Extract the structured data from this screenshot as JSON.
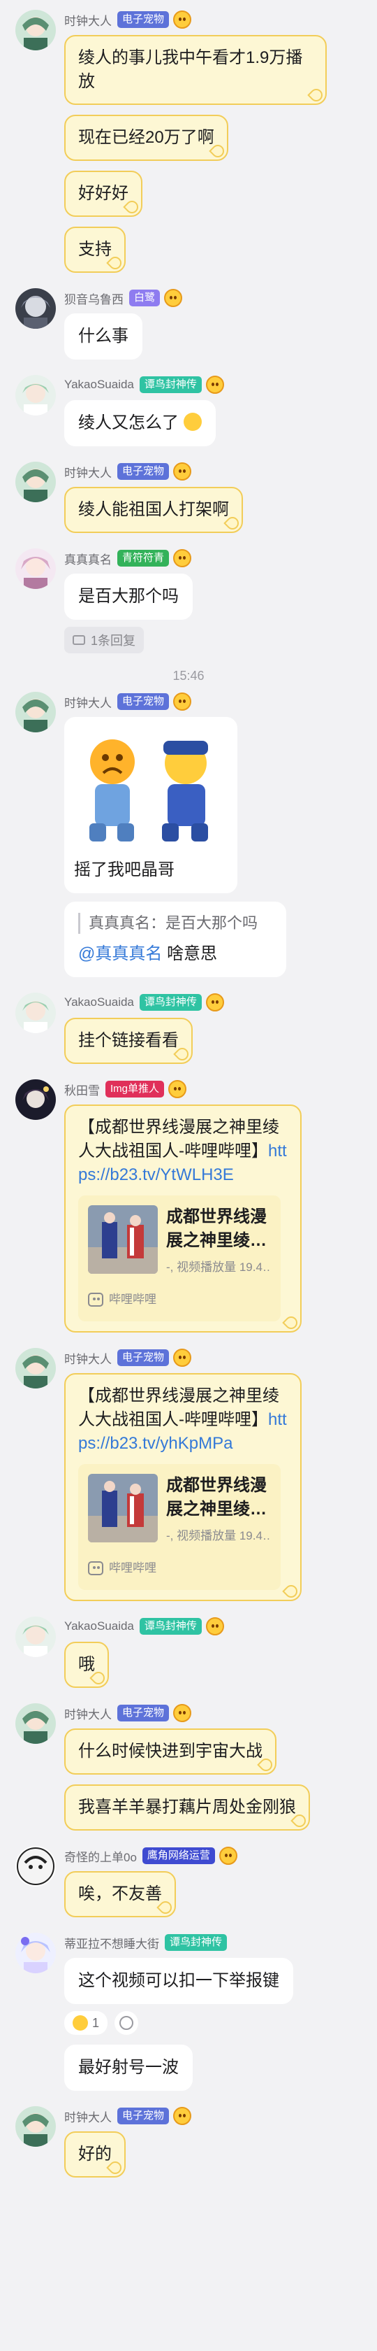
{
  "badges": {
    "pet": "电子宠物",
    "nebula": "白鹭",
    "bird": "谭鸟封神传",
    "green": "青符符青",
    "img": "Img单推人",
    "net": "鹰角网络运营"
  },
  "users": {
    "shizhong": "时钟大人",
    "mu": "狈音乌鲁西",
    "yakao": "YakaoSuaida",
    "zhen": "真真真名",
    "qiu": "秋田雪",
    "qiyi": "奇怪的上单0o",
    "diya": "蒂亚拉不想睡大街"
  },
  "messages": {
    "m1": "绫人的事儿我中午看才1.9万播放",
    "m2": "现在已经20万了啊",
    "m3": "好好好",
    "m4": "支持",
    "m5": "什么事",
    "m6": "绫人又怎么了",
    "m7": "绫人能祖国人打架啊",
    "m8": "是百大那个吗",
    "m9_caption": "摇了我吧晶哥",
    "m9_quote": "真真真名：是百大那个吗",
    "m9_mention": "@真真真名",
    "m9_text": " 啥意思",
    "m10": "挂个链接看看",
    "m11_text": "【成都世界线漫展之神里绫人大战祖国人-哔哩哔哩】",
    "m11_link": "https://b23.tv/YtWLH3E",
    "m12_text": "【成都世界线漫展之神里绫人大战祖国人-哔哩哔哩】",
    "m12_link": "https://b23.tv/yhKpMPa",
    "m13": "哦",
    "m14": "什么时候快进到宇宙大战",
    "m15": "我喜羊羊暴打藕片周处金刚狼",
    "m16": "唉，不友善",
    "m17": "这个视频可以扣一下举报键",
    "m18": "最好射号一波",
    "m19": "好的"
  },
  "reply_count": "1条回复",
  "timestamp": "15:46",
  "card": {
    "title": "成都世界线漫展之神里绫…",
    "sub": "-, 视频播放量 19.4…",
    "source": "哔哩哔哩"
  },
  "reaction_count": "1",
  "colors": {
    "bubble_bg": "#fdf7d4",
    "bubble_border": "#f2cd59",
    "link": "#3479d8",
    "badge_pet": "#5d72d9",
    "badge_bird": "#2fc3a3",
    "badge_green": "#33b25a",
    "badge_img": "#e0305a",
    "badge_net": "#3f4bd1",
    "badge_nebula": "#8e7cf0"
  }
}
